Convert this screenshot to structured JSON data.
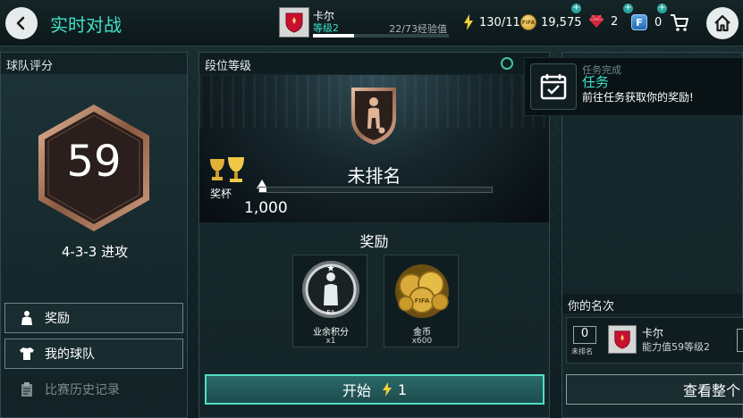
{
  "header": {
    "title": "实时对战",
    "player": {
      "name": "卡尔",
      "level": "等级2",
      "xp_text": "22/73经验值",
      "xp_progress": 0.3
    },
    "resources": {
      "energy": "130/11",
      "coins": "19,575",
      "gems": "2",
      "fifa_points": "0"
    },
    "icons": {
      "back": "back-arrow-icon",
      "home": "home-icon",
      "cart": "cart-icon"
    }
  },
  "team_rating": {
    "heading": "球队评分",
    "rating": "59",
    "formation": "4-3-3 进攻",
    "menu": [
      {
        "label": "奖励",
        "icon": "player-silhouette-icon"
      },
      {
        "label": "我的球队",
        "icon": "jersey-icon"
      },
      {
        "label": "比赛历史记录",
        "icon": "clipboard-icon"
      }
    ]
  },
  "division": {
    "heading": "段位等级",
    "rank_name": "未排名",
    "trophy_label": "奖杯",
    "trophies": "1,000",
    "progress": 0.03,
    "rewards_title": "奖励",
    "rewards": [
      {
        "name": "业余积分",
        "qty": "x1"
      },
      {
        "name": "金币",
        "qty": "x600"
      }
    ],
    "start_label": "开始",
    "start_cost": "1"
  },
  "notification": {
    "subtitle": "任务完成",
    "title": "任务",
    "message": "前往任务获取你的奖励!"
  },
  "ranking": {
    "heading": "你的名次",
    "rank": "0",
    "rank_label": "未排名",
    "name": "卡尔",
    "detail": "能力值59等级2",
    "view_all": "查看整个"
  },
  "colors": {
    "accent": "#3fe0c8",
    "gold": "#d9a93a",
    "bronze": "#b8876a"
  }
}
